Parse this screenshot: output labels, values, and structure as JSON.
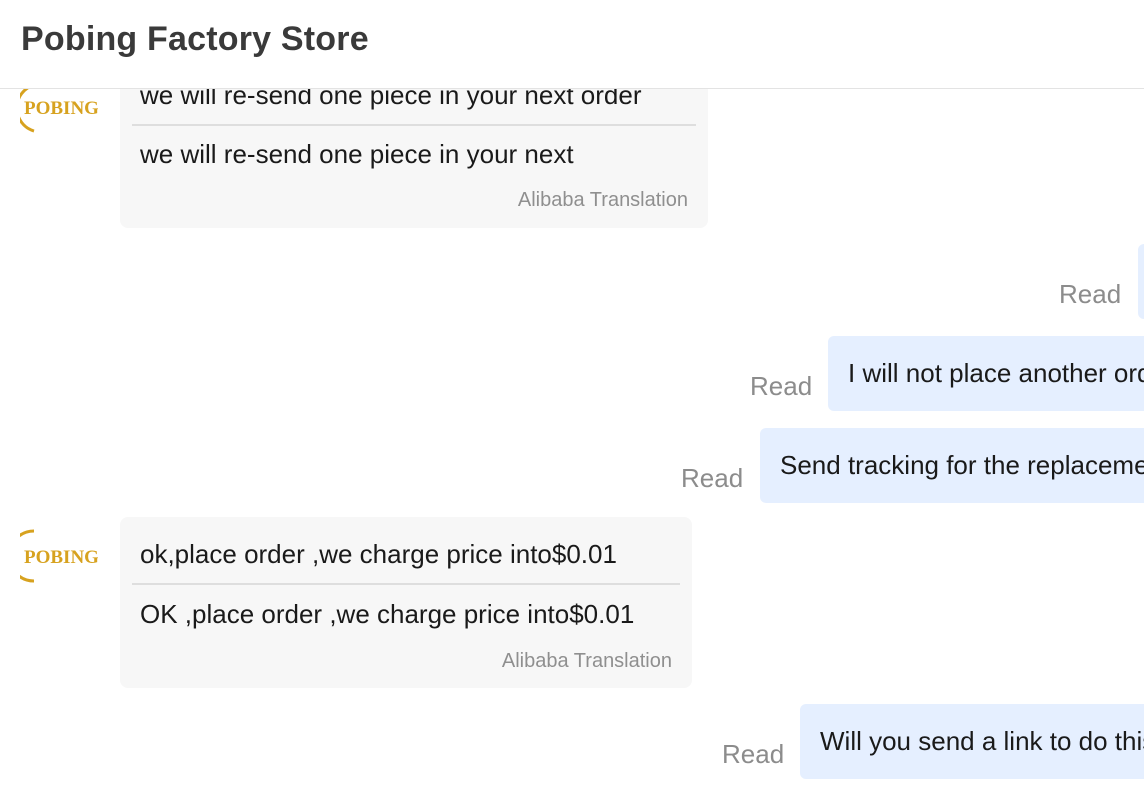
{
  "header": {
    "title": "Pobing Factory Store"
  },
  "avatar": {
    "brand_text": "POBING",
    "brand_color": "#d7a21f"
  },
  "messages": [
    {
      "direction": "incoming",
      "original": "we will  re-send one piece in your next order",
      "translation": "we will re-send one piece in your next",
      "credit": "Alibaba Translation"
    },
    {
      "direction": "outgoing",
      "status": "Read",
      "text": ""
    },
    {
      "direction": "outgoing",
      "status": "Read",
      "text": "I will not place another order"
    },
    {
      "direction": "outgoing",
      "status": "Read",
      "text": "Send tracking for the replacement"
    },
    {
      "direction": "incoming",
      "original": "ok,place order ,we charge price into$0.01",
      "translation": "OK ,place order ,we charge price into$0.01",
      "credit": "Alibaba Translation"
    },
    {
      "direction": "outgoing",
      "status": "Read",
      "text": "Will you send a link to do this"
    }
  ],
  "colors": {
    "incoming_bubble": "#f7f7f7",
    "outgoing_bubble": "#e5efff",
    "read_status": "#8c8c8c",
    "credit_text": "#8f8f8f"
  }
}
